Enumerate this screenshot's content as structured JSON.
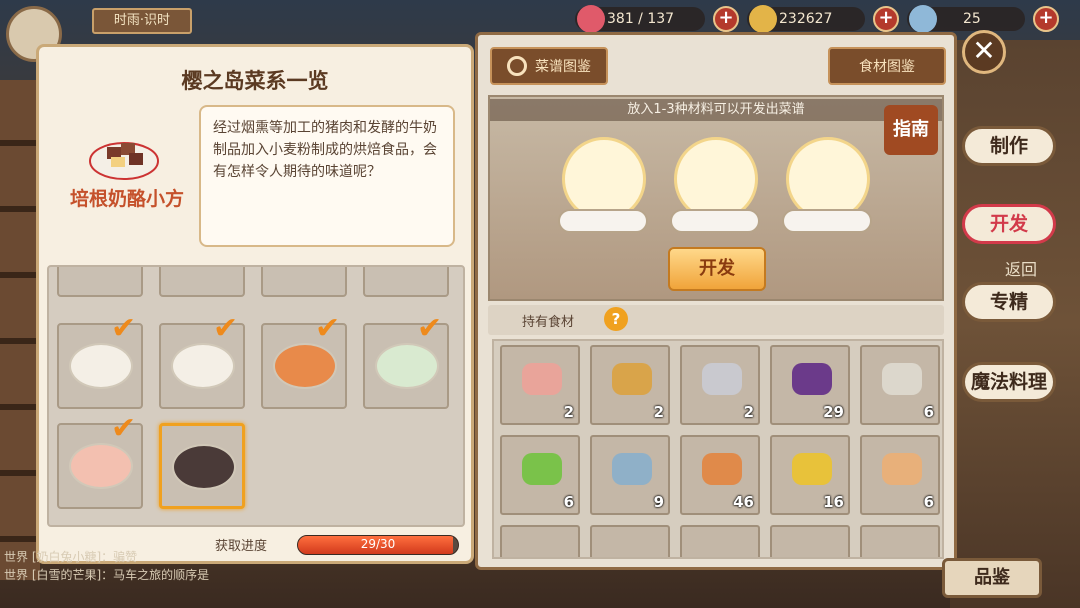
{
  "topbar": {
    "time_tag": "时雨·识时",
    "stamina": "381 / 137",
    "coins": "232627",
    "gems": "25",
    "plus": "+"
  },
  "left_panel": {
    "title": "樱之岛菜系一览",
    "dish_name": "培根奶酪小方",
    "description": "经过烟熏等加工的猪肉和发酵的牛奶制品加入小麦粉制成的烘焙食品，会有怎样令人期待的味道呢？",
    "progress_label": "获取进度",
    "progress_text": "29/30",
    "progress_value": 0.967,
    "dishes": [
      {
        "name": "purple-taro-dish",
        "checked": true
      },
      {
        "name": "sushi-platter",
        "checked": true
      },
      {
        "name": "eel-rice-bowl",
        "checked": true
      },
      {
        "name": "fish-dish",
        "checked": true
      },
      {
        "name": "sashimi-boat",
        "checked": true
      },
      {
        "name": "bacon-cheese-cube",
        "checked": false,
        "selected": true
      }
    ]
  },
  "right_panel": {
    "recipe_book": "菜谱图鉴",
    "ingredient_book": "食材图鉴",
    "hint": "放入1-3种材料可以开发出菜谱",
    "guide": "指南",
    "develop_button": "开发",
    "owned_label": "持有食材",
    "help": "?",
    "ingredients": [
      {
        "name": "pork-belly",
        "count": "2",
        "color": "#e9a49a"
      },
      {
        "name": "potato",
        "count": "2",
        "color": "#d9a44a"
      },
      {
        "name": "fish",
        "count": "2",
        "color": "#c9c9cf"
      },
      {
        "name": "eggplant",
        "count": "29",
        "color": "#6b3a8a"
      },
      {
        "name": "oyster",
        "count": "6",
        "color": "#dcd7cc"
      },
      {
        "name": "lettuce",
        "count": "6",
        "color": "#7ac24a"
      },
      {
        "name": "shrimp",
        "count": "9",
        "color": "#8fb0c8"
      },
      {
        "name": "prawn",
        "count": "46",
        "color": "#e08a4a"
      },
      {
        "name": "yellow-fish",
        "count": "16",
        "color": "#e8c23a"
      },
      {
        "name": "egg",
        "count": "6",
        "color": "#e8b07a"
      }
    ]
  },
  "side_menu": {
    "make": "制作",
    "develop": "开发",
    "back": "返回",
    "specialize": "专精",
    "magic": "魔法料理",
    "identify": "品鉴",
    "close": "✕"
  },
  "chat": [
    "世界 [奶白兔小糖]：骗赞",
    "世界 [白雪的芒果]：马车之旅的顺序是"
  ]
}
